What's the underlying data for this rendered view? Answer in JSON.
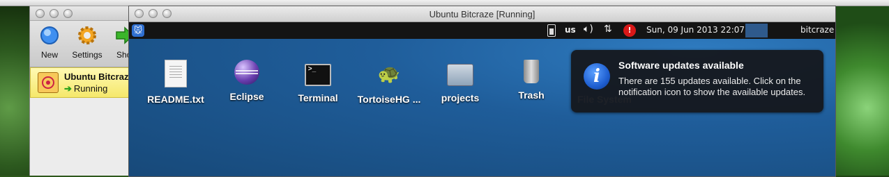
{
  "vbox": {
    "toolbar": [
      {
        "label": "New",
        "icon": "new-icon"
      },
      {
        "label": "Settings",
        "icon": "gear-icon"
      },
      {
        "label": "Sho",
        "icon": "show-icon"
      }
    ],
    "vm": {
      "name": "Ubuntu Bitcraze",
      "state": "Running"
    }
  },
  "vm_window": {
    "title": "Ubuntu Bitcraze [Running]"
  },
  "panel": {
    "keyboard_layout": "us",
    "clock": "Sun, 09 Jun 2013 22:07",
    "username": "bitcraze"
  },
  "desktop": {
    "icons": [
      {
        "label": "README.txt",
        "icon": "text-file-icon"
      },
      {
        "label": "Eclipse",
        "icon": "eclipse-icon"
      },
      {
        "label": "Terminal",
        "icon": "terminal-icon"
      },
      {
        "label": "TortoiseHG ...",
        "icon": "tortoisehg-icon"
      },
      {
        "label": "projects",
        "icon": "folder-icon"
      },
      {
        "label": "Trash",
        "icon": "trash-icon"
      }
    ],
    "covered_icon": "File System"
  },
  "notification": {
    "title": "Software updates available",
    "body": "There are 155 updates available. Click on the notification icon to show the available updates."
  },
  "colors": {
    "desktop_bg": "#1f5d9a",
    "panel_bg": "#141414",
    "selection": "#f5e86b",
    "alert": "#d81818"
  }
}
